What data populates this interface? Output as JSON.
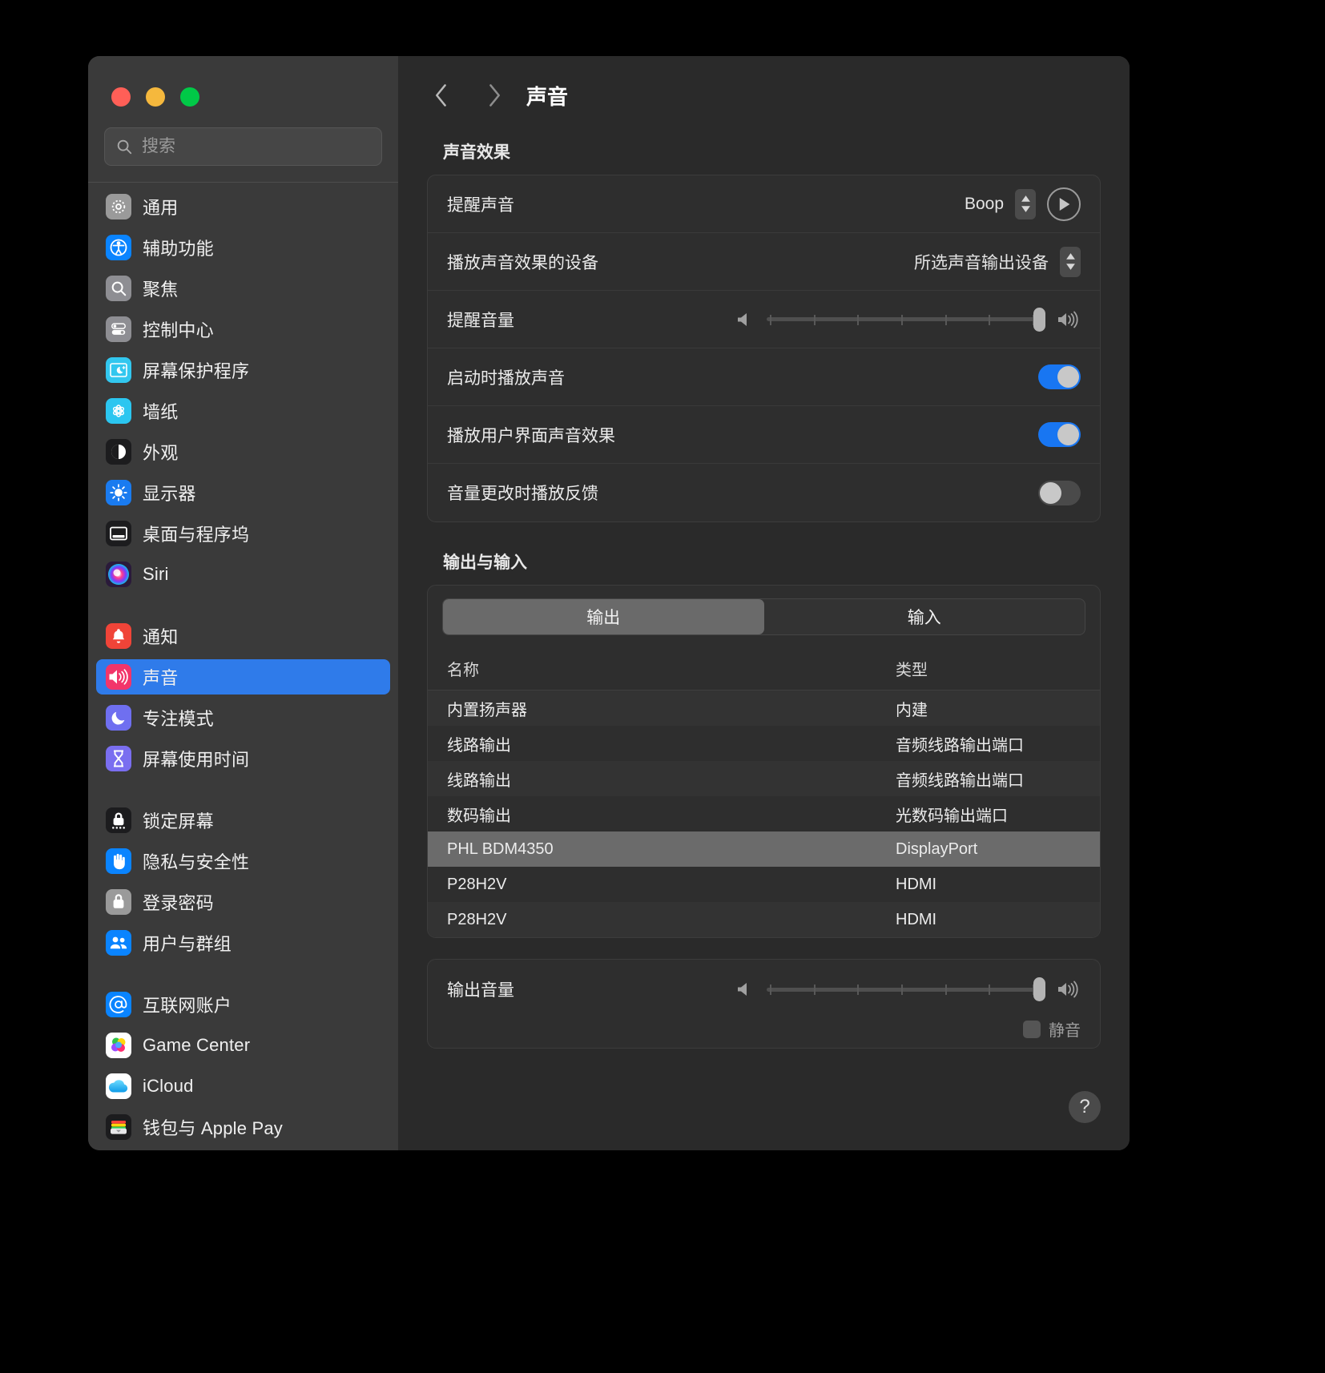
{
  "window": {
    "traffic_lights": [
      "close",
      "minimize",
      "zoom"
    ]
  },
  "sidebar": {
    "search": {
      "placeholder": "搜索",
      "value": "",
      "icon": "search-icon"
    },
    "groups": [
      {
        "items": [
          {
            "label": "通用",
            "icon": "gear-icon",
            "icon_bg": "#9a9a9a",
            "selected": false
          },
          {
            "label": "辅助功能",
            "icon": "accessibility-icon",
            "icon_bg": "#0a84ff",
            "selected": false
          },
          {
            "label": "聚焦",
            "icon": "magnifier-icon",
            "icon_bg": "#8e8e93",
            "selected": false
          },
          {
            "label": "控制中心",
            "icon": "sliders-icon",
            "icon_bg": "#8e8e93",
            "selected": false
          },
          {
            "label": "屏幕保护程序",
            "icon": "screensaver-icon",
            "icon_bg": "#32c7ef",
            "selected": false
          },
          {
            "label": "墙纸",
            "icon": "wallpaper-icon",
            "icon_bg": "#2bc6f0",
            "selected": false
          },
          {
            "label": "外观",
            "icon": "appearance-icon",
            "icon_bg": "#1c1c1e",
            "selected": false
          },
          {
            "label": "显示器",
            "icon": "display-icon",
            "icon_bg": "#1a7bf0",
            "selected": false
          },
          {
            "label": "桌面与程序坞",
            "icon": "desktop-dock-icon",
            "icon_bg": "#1c1c1e",
            "selected": false
          },
          {
            "label": "Siri",
            "icon": "siri-icon",
            "icon_bg": "#2a1a3a",
            "selected": false
          }
        ]
      },
      {
        "items": [
          {
            "label": "通知",
            "icon": "bell-icon",
            "icon_bg": "#f04438",
            "selected": false
          },
          {
            "label": "声音",
            "icon": "speaker-icon",
            "icon_bg": "#f2356a",
            "selected": true
          },
          {
            "label": "专注模式",
            "icon": "moon-icon",
            "icon_bg": "#6f6ff0",
            "selected": false
          },
          {
            "label": "屏幕使用时间",
            "icon": "hourglass-icon",
            "icon_bg": "#7a6ef0",
            "selected": false
          }
        ]
      },
      {
        "items": [
          {
            "label": "锁定屏幕",
            "icon": "lock-dots-icon",
            "icon_bg": "#1c1c1e",
            "selected": false
          },
          {
            "label": "隐私与安全性",
            "icon": "hand-icon",
            "icon_bg": "#0a84ff",
            "selected": false
          },
          {
            "label": "登录密码",
            "icon": "padlock-icon",
            "icon_bg": "#9a9a9a",
            "selected": false
          },
          {
            "label": "用户与群组",
            "icon": "users-icon",
            "icon_bg": "#0a84ff",
            "selected": false
          }
        ]
      },
      {
        "items": [
          {
            "label": "互联网账户",
            "icon": "at-sign-icon",
            "icon_bg": "#0a84ff",
            "selected": false
          },
          {
            "label": "Game Center",
            "icon": "game-center-icon",
            "icon_bg": "#ffffff",
            "selected": false
          },
          {
            "label": "iCloud",
            "icon": "cloud-icon",
            "icon_bg": "#ffffff",
            "selected": false
          },
          {
            "label": "钱包与 Apple Pay",
            "icon": "wallet-icon",
            "icon_bg": "#1c1c1e",
            "selected": false
          }
        ]
      }
    ]
  },
  "toolbar": {
    "back_icon": "chevron-left-icon",
    "forward_icon": "chevron-right-icon",
    "title": "声音"
  },
  "sound_effects": {
    "section_title": "声音效果",
    "alert_sound": {
      "label": "提醒声音",
      "value": "Boop",
      "stepper_icon": "chevron-updown-icon",
      "play_icon": "play-icon"
    },
    "effects_device": {
      "label": "播放声音效果的设备",
      "value": "所选声音输出设备",
      "stepper_icon": "chevron-updown-icon"
    },
    "alert_volume": {
      "label": "提醒音量",
      "low_icon": "speaker-low-icon",
      "high_icon": "speaker-high-icon",
      "value_percent": 100,
      "ticks": 7
    },
    "toggles": [
      {
        "label": "启动时播放声音",
        "state": "on"
      },
      {
        "label": "播放用户界面声音效果",
        "state": "on"
      },
      {
        "label": "音量更改时播放反馈",
        "state": "off"
      }
    ]
  },
  "output_input": {
    "section_title": "输出与输入",
    "tabs": [
      {
        "label": "输出",
        "active": true
      },
      {
        "label": "输入",
        "active": false
      }
    ],
    "columns": [
      "名称",
      "类型"
    ],
    "devices": [
      {
        "name": "内置扬声器",
        "type": "内建",
        "selected": false
      },
      {
        "name": "线路输出",
        "type": "音频线路输出端口",
        "selected": false
      },
      {
        "name": "线路输出",
        "type": "音频线路输出端口",
        "selected": false
      },
      {
        "name": "数码输出",
        "type": "光数码输出端口",
        "selected": false
      },
      {
        "name": "PHL BDM4350",
        "type": "DisplayPort",
        "selected": true
      },
      {
        "name": "P28H2V",
        "type": "HDMI",
        "selected": false
      },
      {
        "name": "P28H2V",
        "type": "HDMI",
        "selected": false
      }
    ]
  },
  "output_volume": {
    "label": "输出音量",
    "low_icon": "speaker-low-icon",
    "high_icon": "speaker-high-icon",
    "value_percent": 100,
    "ticks": 7,
    "mute": {
      "label": "静音",
      "checked": false
    }
  },
  "help": {
    "label": "?",
    "icon": "question-mark-icon"
  },
  "colors": {
    "accent": "#2f7bea",
    "toggle_on": "#1876f2",
    "selected_row": "#6b6b6b",
    "window_bg": "#2a2a2a",
    "sidebar_bg": "#3a3a3a"
  }
}
